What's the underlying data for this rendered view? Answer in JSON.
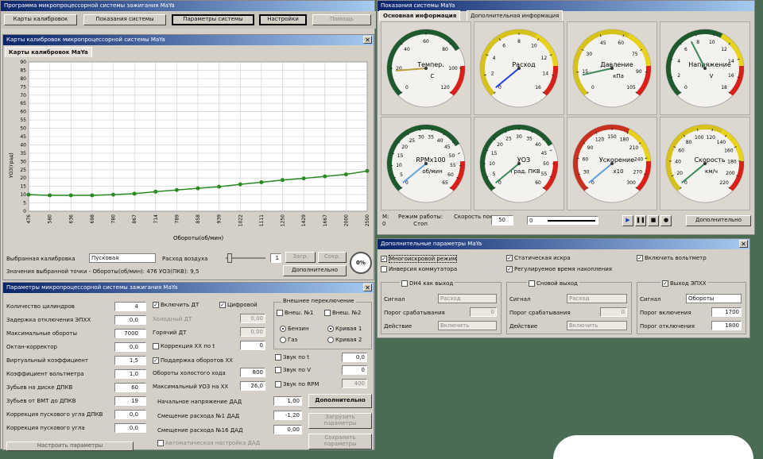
{
  "main_tabs": [
    "Карты калибровок",
    "Показания системы",
    "Параметры системы",
    "Настройки",
    "Помощь"
  ],
  "main_title": "Программа микропроцессорной системы зажигания MaYa",
  "maps": {
    "title": "Карты калибровок микропроцессорной системы MaYa",
    "tab": "Карты калибровок MaYa"
  },
  "chart_data": {
    "type": "line",
    "xlabel": "Обороты(об/мин)",
    "ylabel": "УОЗ(град)",
    "x_ticks": [
      "476",
      "580",
      "636",
      "698",
      "780",
      "867",
      "714",
      "789",
      "858",
      "939",
      "1022",
      "1111",
      "1250",
      "1429",
      "1667",
      "2000",
      "2500"
    ],
    "values": [
      10,
      9.6,
      9.6,
      9.6,
      10,
      10.6,
      11.8,
      12.8,
      13.8,
      14.8,
      16.2,
      17.5,
      18.8,
      19.8,
      21,
      22.2,
      24.3
    ],
    "yticks": [
      "90",
      "85",
      "80",
      "75",
      "70",
      "65",
      "60",
      "55",
      "50",
      "45",
      "40",
      "35",
      "30",
      "25",
      "20",
      "15",
      "10",
      "5",
      "0"
    ],
    "ylim": [
      0,
      90
    ],
    "grid": true,
    "line_color": "#2a8a22"
  },
  "map_controls": {
    "calib_label": "Выбранная калибровка",
    "calib_value": "Пусковая",
    "air_label": "Расход воздуха",
    "air_value": "1",
    "load_btn": "Загр.",
    "save_btn": "Сохр.",
    "point_text": "Значения выбранной точки - Обороты(об/мин): 476 УОЗ(ПКВ): 9,5",
    "extra_btn": "Дополнительно",
    "zero": "0%"
  },
  "params": {
    "title": "Параметры микропроцессорной системы зажигания MaYa",
    "left_labels": [
      "Количество цилиндров",
      "Задержка отключения ЭПХХ",
      "Максимальные обороты",
      "Октан-корректор",
      "Виртуальный коэффициент",
      "Коэффициент вольтметра",
      "Зубьев на диске ДПКВ",
      "Зубьев от ВМТ до ДПКВ",
      "Коррекция пускового угла ДПКВ",
      "Коррекция пускового угла"
    ],
    "left_values": [
      "4",
      "0,0",
      "7000",
      "0,0",
      "1,5",
      "1,0",
      "60",
      "19",
      "0,0",
      "0,0"
    ],
    "checks_a": [
      {
        "t": "Включить ДТ",
        "c": true
      },
      {
        "t": "Цифровой",
        "c": true
      },
      {
        "t": "Холодный ДТ",
        "c": false,
        "g": true
      },
      {
        "t": "Горячий ДТ",
        "c": false,
        "g": true
      },
      {
        "t": "Коррекция XX по t",
        "c": false
      }
    ],
    "checks_a_vals": [
      "0,00",
      "0,00",
      "0"
    ],
    "support_xx": "Поддержка оборотов XX",
    "idle_rpm_label": "Обороты холостого хода",
    "idle_rpm": "800",
    "max_uoz_label": "Максимальный УОЗ на XX",
    "max_uoz": "26,0",
    "ext_title": "Внешнее переключение",
    "ext_n1": "Внеш. №1",
    "ext_n2": "Внеш. №2",
    "benzin": "Бензин",
    "gaz": "Газ",
    "curve1": "Кривая 1",
    "curve2": "Кривая 2",
    "snd_t": "Звук по t",
    "snd_v": "Звук по V",
    "snd_rpm": "Звук по RPM",
    "snd_t_val": "0",
    "snd_v_val": "0,0",
    "snd_rpm_val": "400",
    "dad_labels": [
      "Начальное напряжение ДАД",
      "Смещение расхода №1 ДАД",
      "Смещение расхода №16 ДАД"
    ],
    "dad_vals": [
      "1,00",
      "-1,20",
      "0,00"
    ],
    "auto_dad": "Автоматическая настройка ДАД",
    "btn_more": "Дополнительно",
    "btn_load": "Загрузить параметры",
    "btn_save": "Сохранить параметры",
    "btn_bottom": "Настроить параметры"
  },
  "gauges_win": {
    "title": "Показания системы MaYa",
    "tab1": "Основная информация",
    "tab2": "Дополнительная информация"
  },
  "gauges": [
    {
      "label": "Темпер.",
      "unit": "C",
      "ticks": [
        "0",
        "20",
        "40",
        "60",
        "80",
        "100",
        "120"
      ],
      "value": 0.15,
      "ring": "#1f5a2e",
      "red": true,
      "yellow": false
    },
    {
      "label": "Расход",
      "unit": "",
      "ticks": [
        "0",
        "2",
        "4",
        "6",
        "8",
        "10",
        "12",
        "14",
        "16"
      ],
      "value": 0.02,
      "ring": "#d6c21a",
      "red": true,
      "yellow": true
    },
    {
      "label": "Давление",
      "unit": "кПа",
      "ticks": [
        "0",
        "15",
        "30",
        "45",
        "60",
        "75",
        "90",
        "105"
      ],
      "value": 0.12,
      "ring": "#d6c21a",
      "red": true,
      "yellow": true
    },
    {
      "label": "Напряжение",
      "unit": "V",
      "ticks": [
        "0",
        "2",
        "4",
        "6",
        "8",
        "10",
        "12",
        "14",
        "16",
        "18"
      ],
      "value": 0.4,
      "ring": "#1f5a2e",
      "red": true,
      "yellow": true
    },
    {
      "label": "RPMx100",
      "unit": "об/мин",
      "ticks": [
        "0",
        "5",
        "10",
        "15",
        "20",
        "25",
        "30",
        "35",
        "40",
        "45",
        "50",
        "55",
        "60",
        "65"
      ],
      "value": 0.02,
      "ring": "#1f5a2e",
      "red": true,
      "yellow": false
    },
    {
      "label": "УОЗ",
      "unit": "Град. ПКВ",
      "ticks": [
        "0",
        "5",
        "10",
        "15",
        "20",
        "25",
        "30",
        "35",
        "40",
        "45",
        "50",
        "55",
        "60"
      ],
      "value": 0.02,
      "ring": "#1f5a2e",
      "red": true,
      "yellow": false
    },
    {
      "label": "Ускорение",
      "unit": "x10",
      "ticks": [
        "0",
        "30",
        "60",
        "90",
        "120",
        "150",
        "180",
        "210",
        "240",
        "270",
        "300"
      ],
      "value": 0.02,
      "ring": "#c83020",
      "red": true,
      "yellow": true
    },
    {
      "label": "Скорость",
      "unit": "км/ч",
      "ticks": [
        "0",
        "20",
        "40",
        "60",
        "80",
        "100",
        "120",
        "140",
        "160",
        "180",
        "200",
        "220"
      ],
      "value": 0.02,
      "ring": "#d6c21a",
      "red": true,
      "yellow": true
    }
  ],
  "gauge_bottom": {
    "m": "M:",
    "m_val": "0",
    "mode_label": "Режим работы:",
    "mode_val": "Стоп",
    "speed_label": "Скорость показа",
    "speed_val": "50",
    "slider_val": "0",
    "extra_btn": "Дополнительно"
  },
  "extra": {
    "title": "Дополнительные параметры MaYa",
    "multispark": "Многоискровой режим",
    "inv": "Инверсия коммутатора",
    "static": "Статическая искра",
    "reg_time": "Регулируемое время накопления",
    "voltmeter": "Включить вольтметр",
    "g1": {
      "title": "DH4 как выход",
      "signal": "Сигнал",
      "signal_val": "Расход",
      "threshold": "Порог срабатывания",
      "thr_val": "0",
      "action": "Действие",
      "action_val": "Включить"
    },
    "g2": {
      "title": "Сновой выход",
      "signal": "Сигнал",
      "signal_val": "Расход",
      "threshold": "Порог срабатывания",
      "thr_val": "0",
      "action": "Действие",
      "action_val": "Включить"
    },
    "g3": {
      "title": "Выход ЭПХХ",
      "signal": "Сигнал",
      "signal_val": "Обороты",
      "on": "Порог включения",
      "on_val": "1700",
      "off": "Порог отключения",
      "off_val": "1800"
    }
  }
}
